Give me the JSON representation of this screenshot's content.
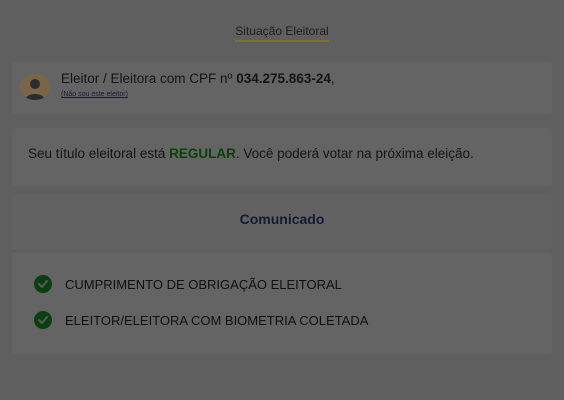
{
  "page": {
    "title": "Situação Eleitoral"
  },
  "voter": {
    "prefix": "Eleitor / Eleitora com CPF nº ",
    "cpf": "034.275.863-24",
    "suffix": ",",
    "not_you_link": "(Não sou este eleitor)",
    "avatar_icon": "user-avatar-icon"
  },
  "status": {
    "before": "Seu título eleitoral está ",
    "value": "REGULAR",
    "after": ". Você poderá votar na próxima eleição.",
    "value_color": "#0a420a"
  },
  "notice": {
    "title": "Comunicado",
    "items": [
      {
        "label": "CUMPRIMENTO DE OBRIGAÇÃO ELEITORAL",
        "icon": "check-circle-icon"
      },
      {
        "label": "ELEITOR/ELEITORA COM BIOMETRIA COLETADA",
        "icon": "check-circle-icon"
      }
    ]
  }
}
